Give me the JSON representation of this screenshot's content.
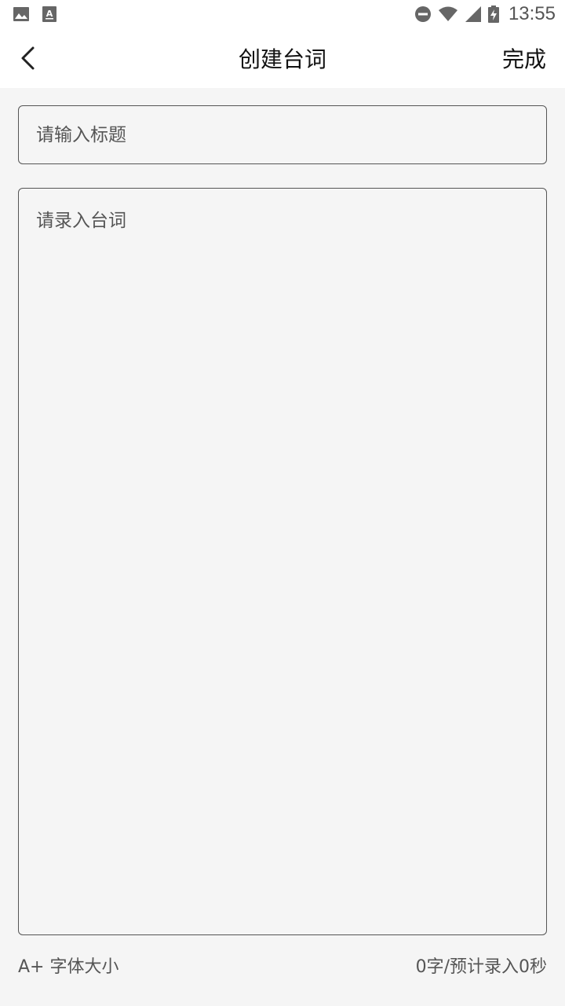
{
  "status_bar": {
    "time": "13:55",
    "left_icons": [
      "image-icon",
      "text-recognition-icon"
    ],
    "right_icons": [
      "do-not-disturb-icon",
      "wifi-icon",
      "signal-icon",
      "battery-charging-icon"
    ]
  },
  "nav": {
    "title": "创建台词",
    "done_label": "完成",
    "back_icon": "chevron-left-icon"
  },
  "form": {
    "title_placeholder": "请输入标题",
    "title_value": "",
    "script_placeholder": "请录入台词",
    "script_value": ""
  },
  "footer": {
    "font_size_label": "A+ 字体大小",
    "word_count_label": "0字/预计录入0秒"
  },
  "colors": {
    "background": "#f5f5f5",
    "bar_background": "#ffffff",
    "border": "#555555",
    "text": "#222222"
  }
}
